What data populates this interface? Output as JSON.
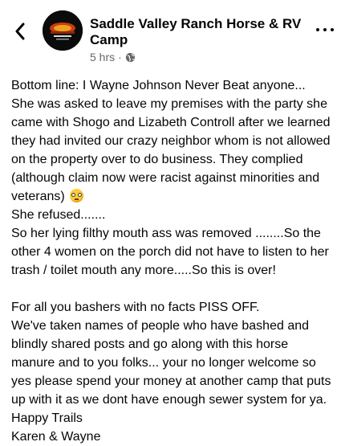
{
  "header": {
    "back_icon": "chevron-left-icon",
    "page_name": "Saddle Valley Ranch Horse & RV Camp",
    "time": "5 hrs",
    "separator": "·",
    "privacy_icon": "globe-icon",
    "more_icon": "ellipsis-icon"
  },
  "post": {
    "lines": [
      "Bottom line: I Wayne Johnson Never Beat anyone...",
      "She was asked to leave my premises with the party she",
      "came with Shogo and Lizabeth Controll after we learned",
      "they had invited our crazy neighbor whom is not allowed",
      "on the property over to do business. They complied",
      "(although claim now were racist against minorities and",
      "veterans)",
      "She refused.......",
      "So her lying filthy mouth ass was removed ........So the",
      "other 4 women on the porch did not have to listen to her",
      "trash / toilet mouth any more.....So this is over!",
      " For all you bashers with no facts  PISS OFF.",
      "We've taken names of people who have bashed and",
      "blindly shared posts and go along with this horse",
      "manure and to you folks... your no longer welcome so",
      "yes please spend your money at another camp that puts",
      "up with it as we dont have enough sewer system for ya.",
      "Happy Trails",
      "Karen & Wayne"
    ],
    "emoji": "eye-roll-emoji"
  }
}
